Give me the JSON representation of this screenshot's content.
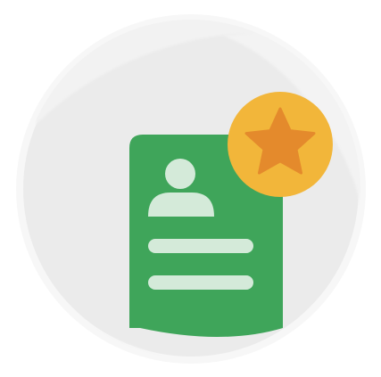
{
  "illustration": {
    "icon_name": "contact-card-with-star-badge",
    "parts": {
      "backdrop": "circle-badge",
      "card": "contact-card-icon",
      "avatar": "person-icon",
      "lines": "text-lines",
      "badge": "star-icon"
    },
    "colors": {
      "circle_fill": "#ebebeb",
      "circle_highlight": "#f4f4f4",
      "circle_ring": "#f8f8f8",
      "card_green": "#3fa55a",
      "card_detail": "#d4ead9",
      "badge_yellow": "#f2b63a",
      "star_orange": "#e48a2c"
    }
  }
}
